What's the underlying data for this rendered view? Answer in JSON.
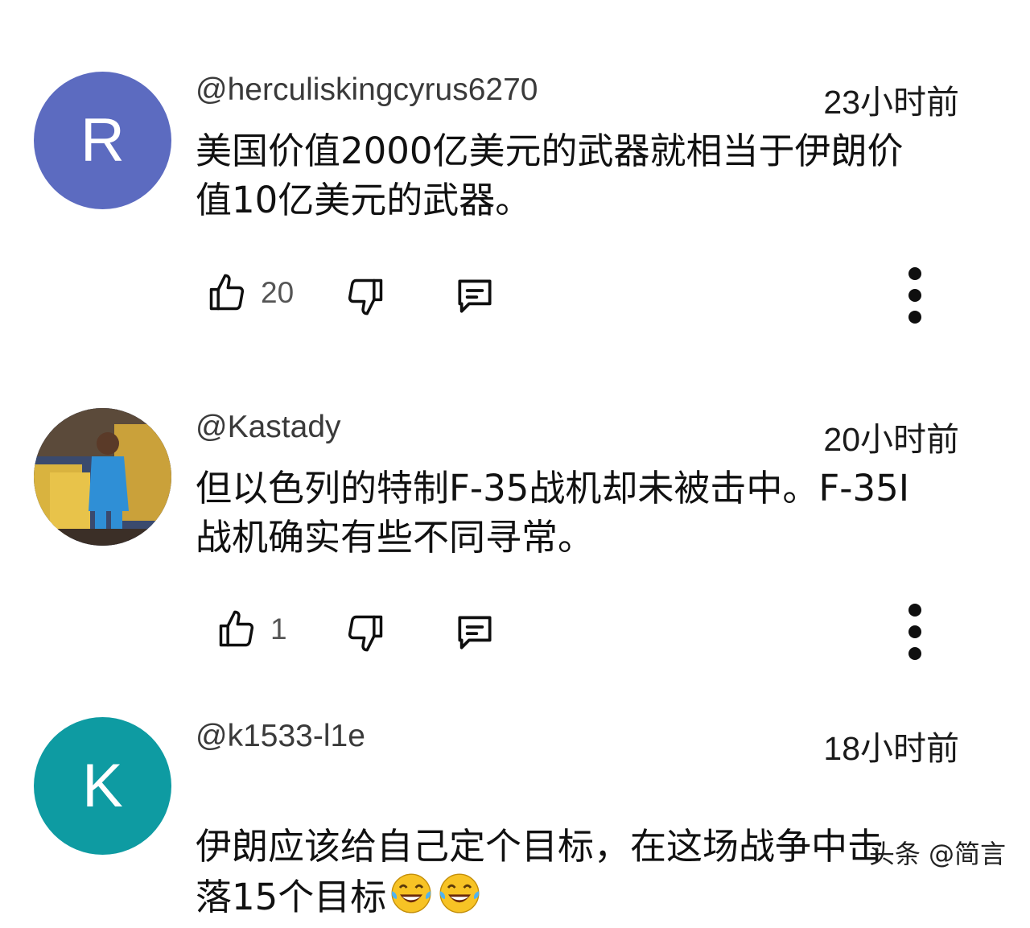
{
  "comments": [
    {
      "handle": "@herculiskingcyrus6270",
      "time": "23小时前",
      "avatar_letter": "R",
      "avatar_color": "#5c6bc0",
      "text": "美国价值2000亿美元的武器就相当于伊朗价\n值10亿美元的武器。",
      "likes": "20"
    },
    {
      "handle": "@Kastady",
      "time": "20小时前",
      "avatar_letter": "",
      "avatar_color": "#2c3a5e",
      "text": "但以色列的特制F-35战机却未被击中。F-35I\n战机确实有些不同寻常。",
      "likes": "1"
    },
    {
      "handle": "@k1533-l1e",
      "time": "18小时前",
      "avatar_letter": "K",
      "avatar_color": "#0e9ba2",
      "text": "伊朗应该给自己定个目标，在这场战争中击\n落15个目标",
      "emoji": "laughing-tears"
    }
  ],
  "watermark": "头条 @简言"
}
